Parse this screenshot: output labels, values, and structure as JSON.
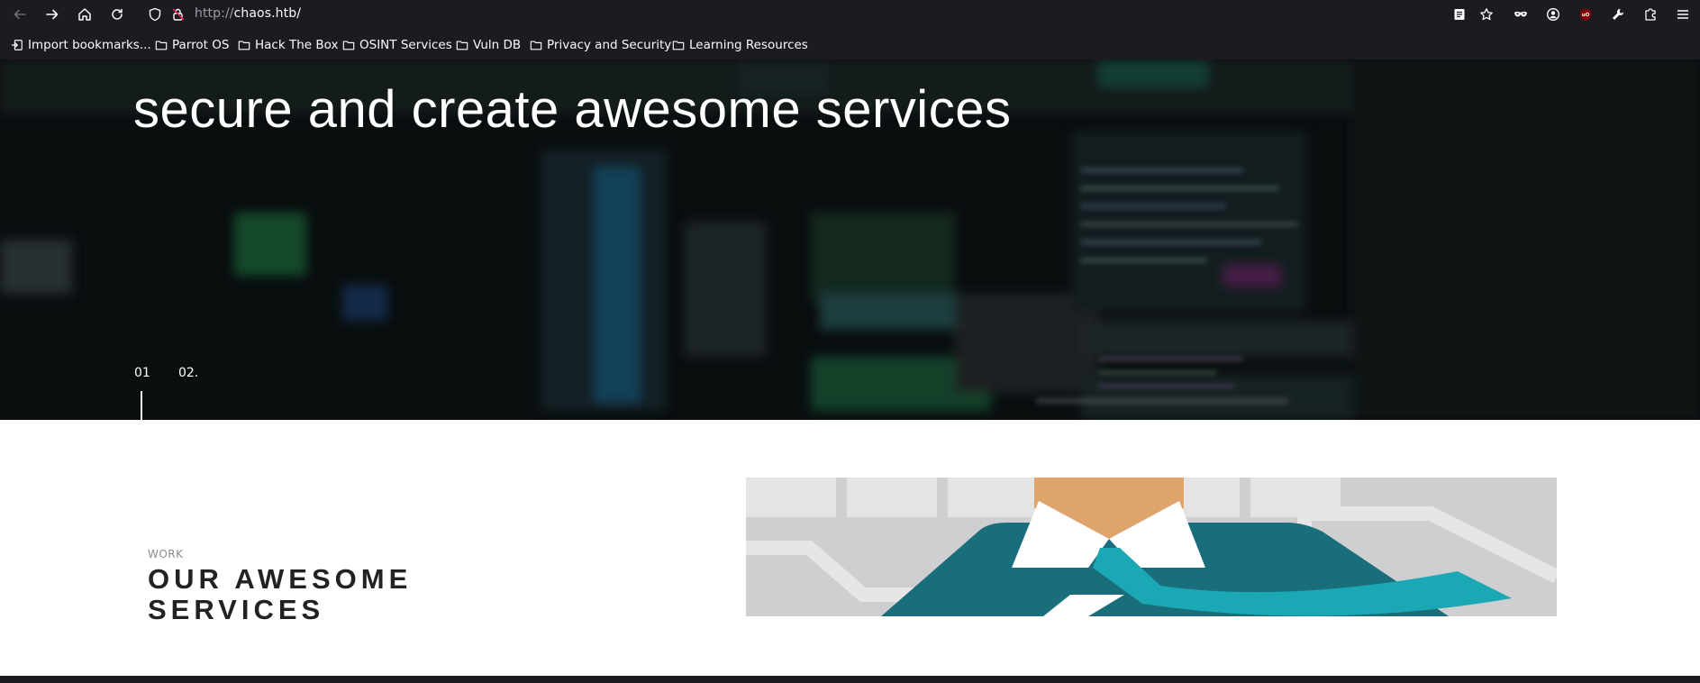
{
  "browser": {
    "url_scheme": "http://",
    "url_host": "chaos.htb/"
  },
  "bookmarks": [
    {
      "label": "Import bookmarks...",
      "icon": "import-icon"
    },
    {
      "label": "Parrot OS",
      "icon": "folder-icon"
    },
    {
      "label": "Hack The Box",
      "icon": "folder-icon"
    },
    {
      "label": "OSINT Services",
      "icon": "folder-icon"
    },
    {
      "label": "Vuln DB",
      "icon": "folder-icon"
    },
    {
      "label": "Privacy and Security",
      "icon": "folder-icon"
    },
    {
      "label": "Learning Resources",
      "icon": "folder-icon"
    }
  ],
  "hero": {
    "title": "secure and create awesome services",
    "slides": [
      "01",
      "02."
    ]
  },
  "work": {
    "label": "WORK",
    "title": "OUR AWESOME SERVICES"
  },
  "colors": {
    "browser_bg": "#1c1b22",
    "hero_overlay": "#0c1113",
    "illustration_teal": "#1a6e7c",
    "illustration_cyan": "#1aa8b4",
    "illustration_skin": "#dfa36c"
  }
}
